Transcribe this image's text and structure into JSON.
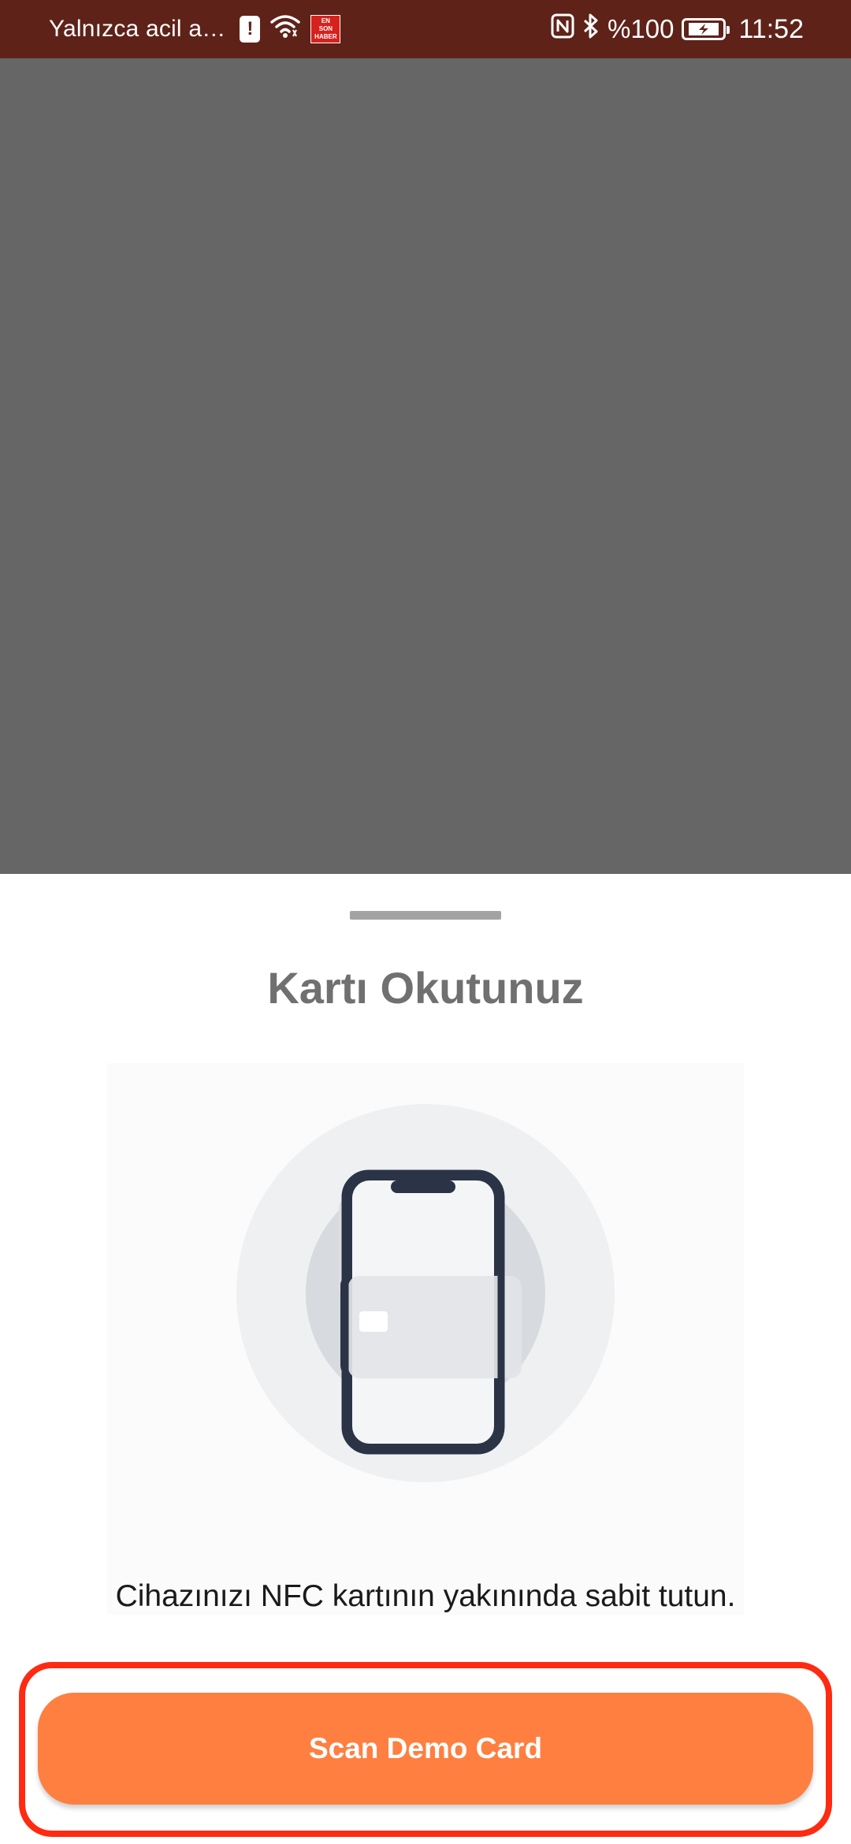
{
  "status_bar": {
    "carrier_text": "Yalnızca acil a…",
    "news_icon_lines": [
      "EN",
      "SON",
      "HABER"
    ],
    "battery_percent": "%100",
    "time": "11:52",
    "icons": [
      "alert-icon",
      "wifi-icon",
      "news-app-icon",
      "nfc-icon",
      "bluetooth-icon",
      "battery-charging-icon"
    ]
  },
  "sheet": {
    "title": "Kartı Okutunuz",
    "illustration_icon": "phone-nfc-card-icon",
    "instruction": "Cihazınızı NFC kartının yakınında sabit tutun.",
    "scan_button_label": "Scan Demo Card"
  },
  "colors": {
    "status_bar_bg": "#5e2219",
    "overlay": "#666666",
    "button_bg": "#ff7f40",
    "highlight_border": "#ff2a12",
    "title_text": "#707070"
  }
}
